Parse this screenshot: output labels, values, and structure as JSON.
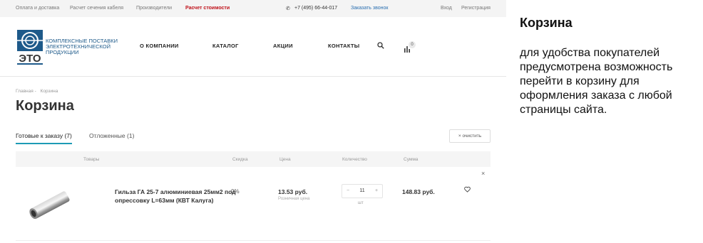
{
  "topbar": {
    "links": [
      "Оплата и доставка",
      "Расчет сечения кабеля",
      "Производители",
      "Расчет стоимости"
    ],
    "phone": "+7 (495) 66-44-017",
    "callback": "Заказать звонок",
    "login": "Вход",
    "register": "Регистрация"
  },
  "logo": {
    "mark_text": "ЭТО",
    "line1": "КОМПЛЕКСНЫЕ ПОСТАВКИ",
    "line2": "ЭЛЕКТРОТЕХНИЧЕСКОЙ",
    "line3": "ПРОДУКЦИИ"
  },
  "nav": [
    "О КОМПАНИИ",
    "КАТАЛОГ",
    "АКЦИИ",
    "КОНТАКТЫ"
  ],
  "cart_count": "0",
  "breadcrumbs": [
    "Главная",
    "-",
    "Корзина"
  ],
  "page_title": "Корзина",
  "tabs": [
    {
      "label": "Готовые к заказу (7)",
      "active": true
    },
    {
      "label": "Отложенные (1)",
      "active": false
    }
  ],
  "clear_label": "очистить",
  "table": {
    "headers": [
      "Товары",
      "Скидка",
      "Цена",
      "Количество",
      "Сумма"
    ],
    "rows": [
      {
        "name": "Гильза ГА 25-7 алюминиевая 25мм2 под опрессовку L=63мм (КВТ Калуга)",
        "discount": "0%",
        "price": "13.53 руб.",
        "price_note": "Розничная цена",
        "quantity": "11",
        "unit": "шт",
        "sum": "148.83 руб."
      }
    ]
  },
  "note": {
    "title": "Корзина",
    "text": "для удобства покупателей предусмотрена возможность перейти в корзину для оформления заказа с любой страницы сайта."
  },
  "colors": {
    "accent": "#1d9bb5",
    "highlight_red": "#c0141c",
    "link_blue": "#2a6fb0"
  }
}
